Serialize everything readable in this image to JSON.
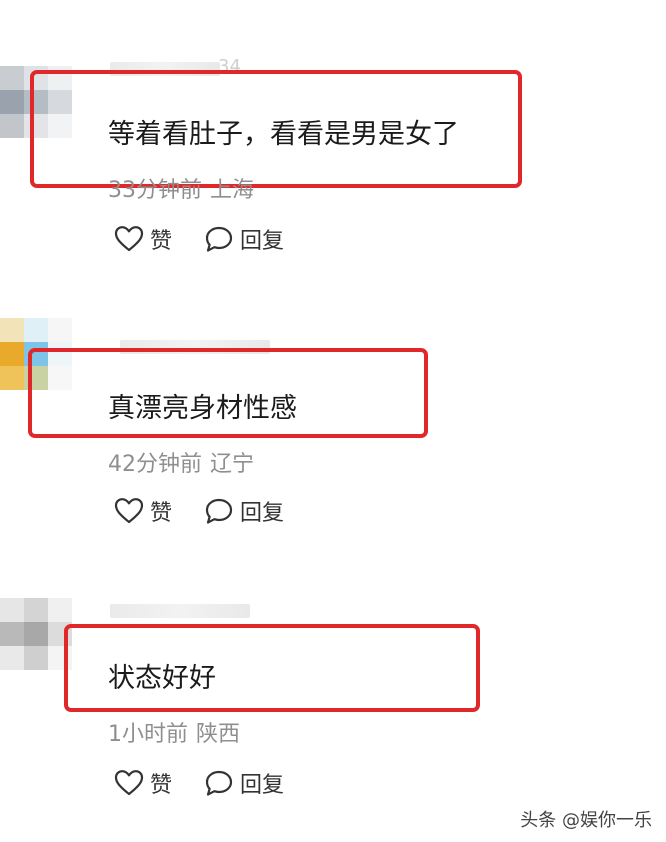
{
  "comments": [
    {
      "name_suffix": "34",
      "text": "等着看肚子，看看是男是女了",
      "time": "33分钟前",
      "location": "上海",
      "like_label": "赞",
      "reply_label": "回复"
    },
    {
      "name_suffix": "",
      "text": "真漂亮身材性感",
      "time": "42分钟前",
      "location": "辽宁",
      "like_label": "赞",
      "reply_label": "回复"
    },
    {
      "name_suffix": "",
      "text": "状态好好",
      "time": "1小时前",
      "location": "陕西",
      "like_label": "赞",
      "reply_label": "回复"
    }
  ],
  "watermark": "头条 @娱你一乐",
  "colors": {
    "highlight": "#e0282b",
    "meta_text": "#8f8f8f"
  },
  "icons": {
    "like": "heart-outline-icon",
    "reply": "speech-bubble-icon"
  }
}
